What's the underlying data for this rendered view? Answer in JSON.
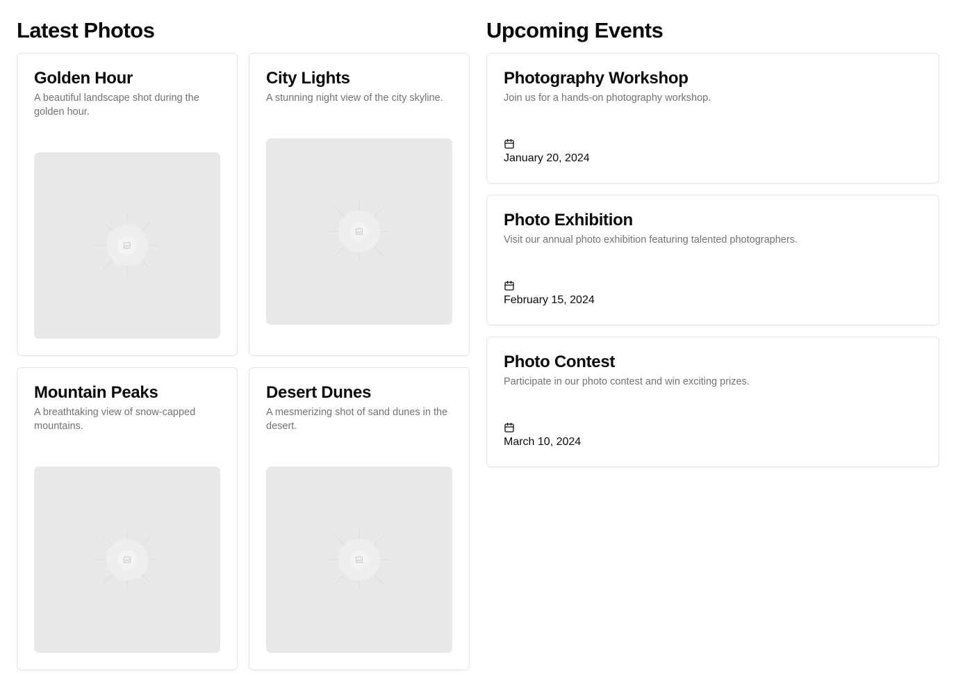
{
  "photos_section": {
    "title": "Latest Photos",
    "photos": [
      {
        "title": "Golden Hour",
        "description": "A beautiful landscape shot during the golden hour.",
        "image_icon": "image-placeholder-icon"
      },
      {
        "title": "City Lights",
        "description": "A stunning night view of the city skyline.",
        "image_icon": "image-placeholder-icon"
      },
      {
        "title": "Mountain Peaks",
        "description": "A breathtaking view of snow-capped mountains.",
        "image_icon": "image-placeholder-icon"
      },
      {
        "title": "Desert Dunes",
        "description": "A mesmerizing shot of sand dunes in the desert.",
        "image_icon": "image-placeholder-icon"
      }
    ]
  },
  "events_section": {
    "title": "Upcoming Events",
    "events": [
      {
        "title": "Photography Workshop",
        "description": "Join us for a hands-on photography workshop.",
        "date": "January 20, 2024",
        "date_icon": "calendar-icon"
      },
      {
        "title": "Photo Exhibition",
        "description": "Visit our annual photo exhibition featuring talented photographers.",
        "date": "February 15, 2024",
        "date_icon": "calendar-icon"
      },
      {
        "title": "Photo Contest",
        "description": "Participate in our photo contest and win exciting prizes.",
        "date": "March 10, 2024",
        "date_icon": "calendar-icon"
      }
    ]
  },
  "colors": {
    "text": "#0a0a0a",
    "muted_text": "#71717a",
    "border": "#e4e4e7",
    "placeholder": "#e8e8e8"
  }
}
